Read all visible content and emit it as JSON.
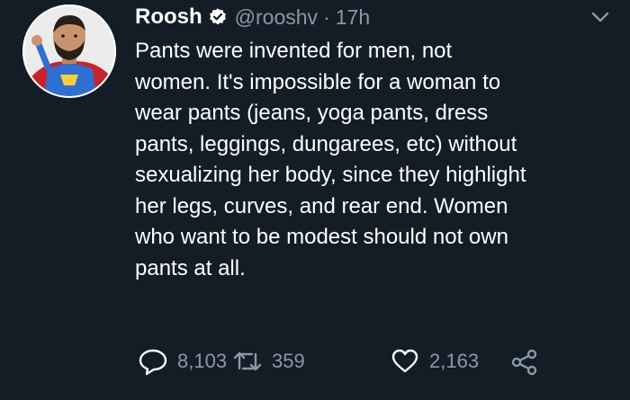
{
  "tweet": {
    "author_name": "Roosh",
    "handle": "@rooshv",
    "separator": "·",
    "time": "17h",
    "text_lines": [
      "Pants were invented for men, not",
      "women. It's impossible for a woman to",
      "wear pants (jeans, yoga pants, dress",
      "pants, leggings, dungarees, etc) without",
      "sexualizing her body, since they highlight",
      "her legs, curves, and rear end. Women",
      "who want to be modest should not own",
      "pants at all."
    ],
    "stats": {
      "replies": "8,103",
      "retweets": "359",
      "likes": "2,163"
    }
  },
  "icons": {
    "verified": "verified-badge-icon",
    "caret": "chevron-down-icon",
    "reply": "reply-icon",
    "retweet": "retweet-icon",
    "like": "heart-icon",
    "share": "share-icon"
  },
  "colors": {
    "background": "#141d26",
    "text": "#ffffff",
    "muted": "#8899a6"
  }
}
